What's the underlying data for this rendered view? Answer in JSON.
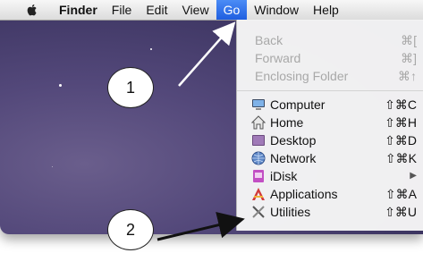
{
  "menubar": {
    "items": [
      "Finder",
      "File",
      "Edit",
      "View",
      "Go",
      "Window",
      "Help"
    ],
    "active_item": "Go"
  },
  "go_menu": {
    "items": [
      {
        "label": "Back",
        "shortcut": "⌘[",
        "enabled": false,
        "icon": ""
      },
      {
        "label": "Forward",
        "shortcut": "⌘]",
        "enabled": false,
        "icon": ""
      },
      {
        "label": "Enclosing Folder",
        "shortcut": "⌘↑",
        "enabled": false,
        "icon": ""
      },
      {
        "label": "Computer",
        "shortcut": "⇧⌘C",
        "enabled": true,
        "icon": "computer-icon"
      },
      {
        "label": "Home",
        "shortcut": "⇧⌘H",
        "enabled": true,
        "icon": "home-icon"
      },
      {
        "label": "Desktop",
        "shortcut": "⇧⌘D",
        "enabled": true,
        "icon": "desktop-icon"
      },
      {
        "label": "Network",
        "shortcut": "⇧⌘K",
        "enabled": true,
        "icon": "network-icon"
      },
      {
        "label": "iDisk",
        "shortcut": "▶",
        "enabled": true,
        "icon": "idisk-icon"
      },
      {
        "label": "Applications",
        "shortcut": "⇧⌘A",
        "enabled": true,
        "icon": "applications-icon"
      },
      {
        "label": "Utilities",
        "shortcut": "⇧⌘U",
        "enabled": true,
        "icon": "utilities-icon"
      }
    ]
  },
  "annotations": {
    "callout_1": "1",
    "callout_2": "2"
  },
  "colors": {
    "menu_highlight": "#2f6de8",
    "arrow": "#111111",
    "arrow_1": "#ffffff"
  }
}
